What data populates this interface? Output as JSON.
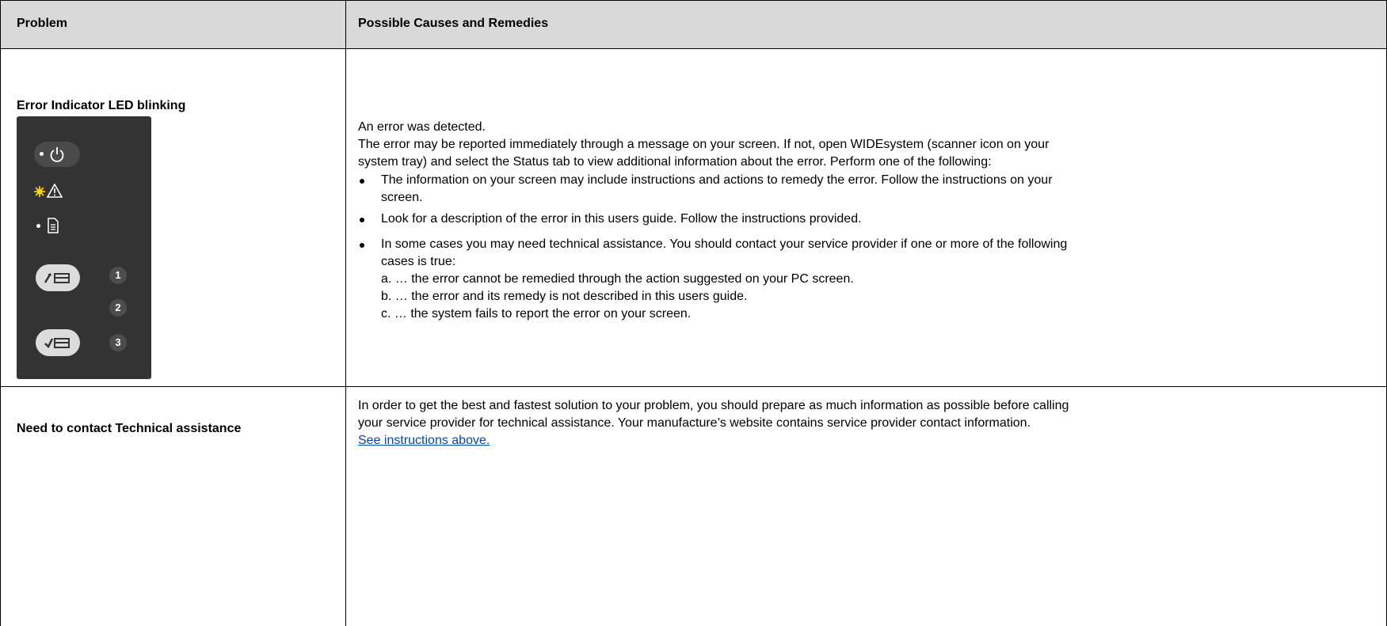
{
  "header": {
    "problem_col": "Problem",
    "causes_col": "Possible Causes and Remedies"
  },
  "rows": [
    {
      "problem": "Error Indicator LED blinking",
      "intro": "An error was detected.",
      "paragraph_line1": "The error may be reported immediately through a message on your screen. If not, open WIDEsystem (scanner icon on your",
      "paragraph_line2": "system tray) and select the Status tab to view additional information about the error. Perform one of the following:",
      "bullets": [
        {
          "line1": "The information on your screen may include instructions and actions to remedy the error. Follow the instructions on your",
          "line2": "screen."
        },
        {
          "line1": "Look for a description of the error in this users guide. Follow the instructions provided."
        },
        {
          "line1": "In some cases you may need technical assistance.  You should contact your service provider if one or more of the following",
          "line2": "cases is true:"
        }
      ],
      "sub_items": [
        "a.  … the error cannot be remedied through the action suggested on your PC screen.",
        "b. …  the error and its remedy is not described in this users guide.",
        "c.  … the system fails to report the error on your screen."
      ],
      "panel_numbers": [
        "1",
        "2",
        "3"
      ]
    },
    {
      "problem": "Need to contact Technical assistance",
      "line1": "In order to get the best and fastest solution to your problem, you should prepare as much information as possible before calling",
      "line2": "your service provider for technical assistance. Your manufacture’s website contains service provider contact information.",
      "link": "See instructions above."
    }
  ],
  "icons": {
    "power": "power-icon",
    "warning": "warning-icon",
    "document": "document-icon",
    "scan_to_file": "scan-button-icon",
    "scan_to_print": "copy-button-icon"
  },
  "colors": {
    "header_bg": "#d9d9d9",
    "panel_bg": "#333333",
    "led_active": "#ffd400",
    "link": "#0645ad"
  }
}
